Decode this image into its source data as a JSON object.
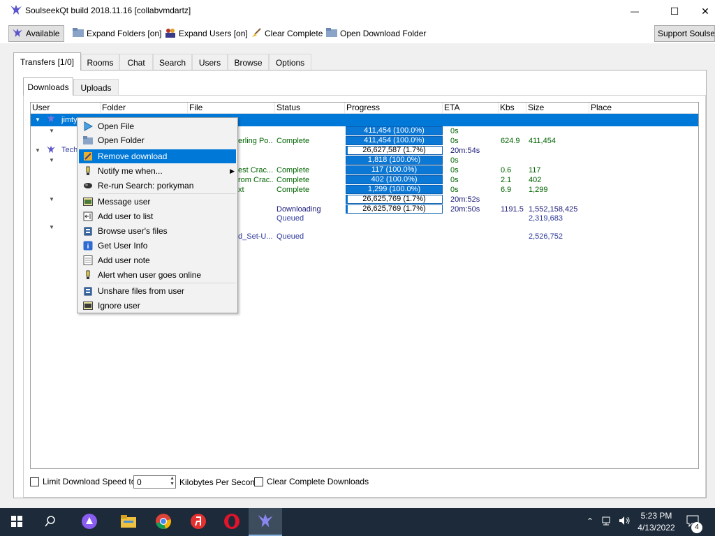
{
  "window": {
    "title": "SoulseekQt build 2018.11.16 [collabvmdartz]",
    "minimize_glyph": "—",
    "maximize_glyph": "☐",
    "close_glyph": "✕"
  },
  "toolbar": {
    "available": "Available",
    "expand_folders": "Expand Folders [on]",
    "expand_users": "Expand Users [on]",
    "clear_complete": "Clear Complete",
    "open_download_folder": "Open Download Folder",
    "support": "Support Soulseek"
  },
  "tabs": [
    "Transfers [1/0]",
    "Rooms",
    "Chat",
    "Search",
    "Users",
    "Browse",
    "Options"
  ],
  "subtabs": [
    "Downloads",
    "Uploads"
  ],
  "columns": [
    "User",
    "Folder",
    "File",
    "Status",
    "Progress",
    "ETA",
    "Kbs",
    "Size",
    "Place"
  ],
  "rows": {
    "user1": "jimtyl...",
    "user2": "Tech",
    "r1": {
      "progress": "411,454 (100.0%)",
      "progress_pct": 100,
      "eta": "0s"
    },
    "r2": {
      "file": "erling Po...",
      "status": "Complete",
      "progress": "411,454 (100.0%)",
      "progress_pct": 100,
      "eta": "0s",
      "kbs": "624.9",
      "size": "411,454"
    },
    "r3": {
      "progress": "26,627,587 (1.7%)",
      "progress_pct": 1.7,
      "eta": "20m:54s"
    },
    "r4": {
      "progress": "1,818 (100.0%)",
      "progress_pct": 100,
      "eta": "0s"
    },
    "r5": {
      "file": "est Crac...",
      "status": "Complete",
      "progress": "117 (100.0%)",
      "progress_pct": 100,
      "eta": "0s",
      "kbs": "0.6",
      "size": "117"
    },
    "r6": {
      "file": "rom Crac...",
      "status": "Complete",
      "progress": "402 (100.0%)",
      "progress_pct": 100,
      "eta": "0s",
      "kbs": "2.1",
      "size": "402"
    },
    "r7": {
      "file": "xt",
      "status": "Complete",
      "progress": "1,299 (100.0%)",
      "progress_pct": 100,
      "eta": "0s",
      "kbs": "6.9",
      "size": "1,299"
    },
    "r8": {
      "progress": "26,625,769 (1.7%)",
      "progress_pct": 1.7,
      "eta": "20m:52s"
    },
    "r9": {
      "status": "Downloading",
      "progress": "26,625,769 (1.7%)",
      "progress_pct": 1.7,
      "eta": "20m:50s",
      "kbs": "1191.5",
      "size": "1,552,158,425"
    },
    "r10": {
      "status": "Queued",
      "size": "2,319,683"
    },
    "r11": {
      "file": "d_Set-U...",
      "status": "Queued",
      "size": "2,526,752"
    }
  },
  "context_menu": {
    "open_file": "Open File",
    "open_folder": "Open Folder",
    "remove_download": "Remove download",
    "notify_me": "Notify me when...",
    "rerun_search": "Re-run Search: porkyman",
    "message_user": "Message user",
    "add_user": "Add user to list",
    "browse_files": "Browse user's files",
    "get_info": "Get User Info",
    "add_note": "Add user note",
    "alert_online": "Alert when user goes online",
    "unshare": "Unshare files from user",
    "ignore": "Ignore user"
  },
  "bottom": {
    "limit_label": "Limit Download Speed to",
    "limit_value": "0",
    "kbps_label": "Kilobytes Per Second",
    "clear_complete_label": "Clear Complete Downloads"
  },
  "taskbar": {
    "time": "5:23 PM",
    "date": "4/13/2022",
    "notif_count": "4"
  },
  "colors": {
    "selection": "#0078d7",
    "progress": "#0b78d6",
    "taskbar": "#1c2a3a"
  }
}
